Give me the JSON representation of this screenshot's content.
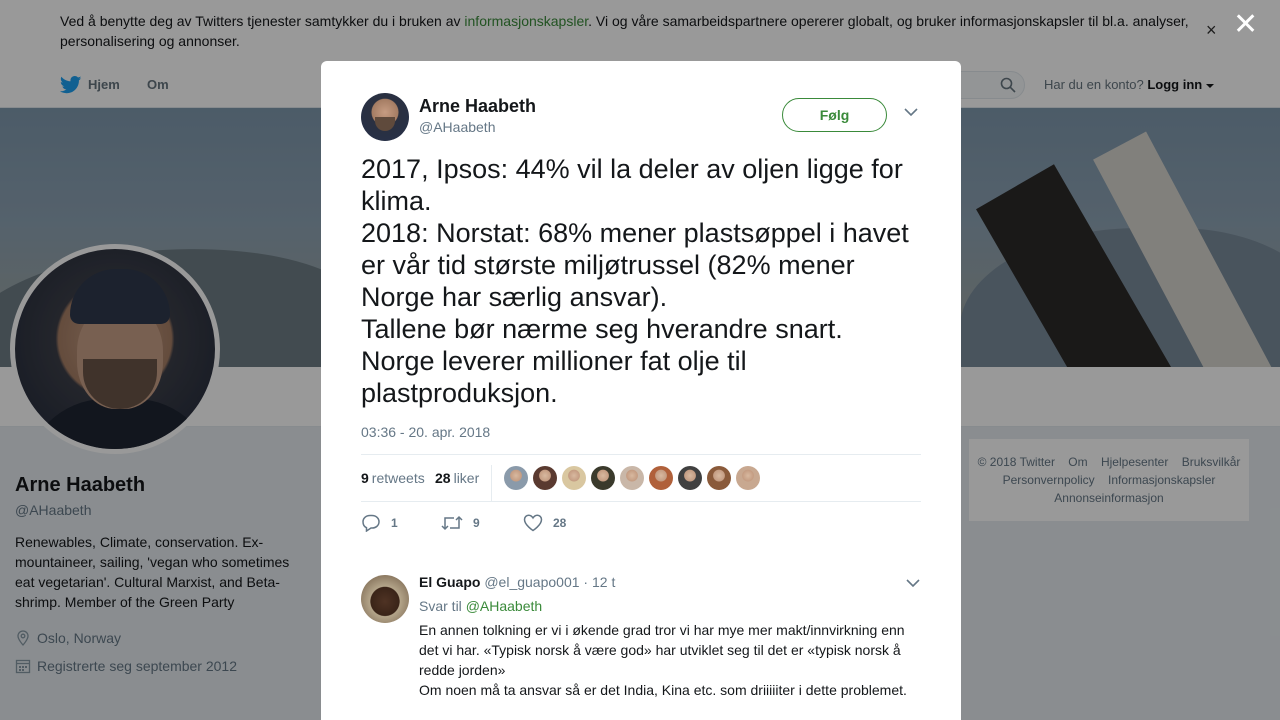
{
  "cookie_banner": {
    "text_before": "Ved å benytte deg av Twitters tjenester samtykker du i bruken av ",
    "link": "informasjonskapsler",
    "text_after": ". Vi og våre samarbeidspartnere opererer globalt, og bruker informasjonskapsler til bl.a. analyser, personalisering og annonser.",
    "close": "×"
  },
  "overlay_close": "✕",
  "nav": {
    "home": "Hjem",
    "about": "Om",
    "have_account": "Har du en konto?",
    "login": "Logg inn"
  },
  "profile": {
    "name": "Arne Haabeth",
    "handle": "@AHaabeth",
    "bio": "Renewables, Climate, conservation. Ex-mountaineer, sailing, 'vegan who sometimes eat vegetarian'. Cultural Marxist, and Beta-shrimp. Member of the Green Party",
    "location": "Oslo, Norway",
    "joined": "Registrerte seg september 2012"
  },
  "footer": {
    "links_row1": [
      "© 2018 Twitter",
      "Om",
      "Hjelpesenter",
      "Bruksvilkår"
    ],
    "links_row2": [
      "Personvernpolicy",
      "Informasjonskapsler"
    ],
    "links_row3": [
      "Annonseinformasjon"
    ]
  },
  "tweet": {
    "author_name": "Arne Haabeth",
    "author_handle": "@AHaabeth",
    "follow_label": "Følg",
    "text": "2017, Ipsos: 44% vil la deler av oljen ligge for klima.\n2018: Norstat: 68% mener plastsøppel i havet er vår tid største miljøtrussel (82% mener Norge har særlig ansvar).\nTallene bør nærme seg hverandre snart. Norge leverer millioner fat olje til plastproduksjon.",
    "timestamp": "03:36 - 20. apr. 2018",
    "retweets_count": "9",
    "retweets_label": "retweets",
    "likes_count": "28",
    "likes_label": "liker",
    "liker_colors": [
      "#8a9aaa",
      "#5a3a30",
      "#d9c7a0",
      "#3a3a2c",
      "#c9b7a8",
      "#b0603a",
      "#404040",
      "#8a5a3a",
      "#c8a890"
    ],
    "actions": {
      "reply_count": "1",
      "retweet_count": "9",
      "like_count": "28"
    }
  },
  "reply": {
    "name": "El Guapo",
    "handle": "@el_guapo001",
    "dot": "·",
    "time": "12 t",
    "reply_to_label": "Svar til",
    "reply_to_handle": "@AHaabeth",
    "text": "En annen tolkning er vi i økende grad tror vi har mye mer makt/innvirkning enn det vi har. «Typisk norsk å være god» har utviklet seg til det er «typisk norsk å redde jorden»\nOm noen må ta ansvar så er det India, Kina etc. som driiiiiter i dette problemet."
  },
  "colors": {
    "accent": "#3a8a3a",
    "text": "#14171a",
    "muted": "#657786"
  }
}
